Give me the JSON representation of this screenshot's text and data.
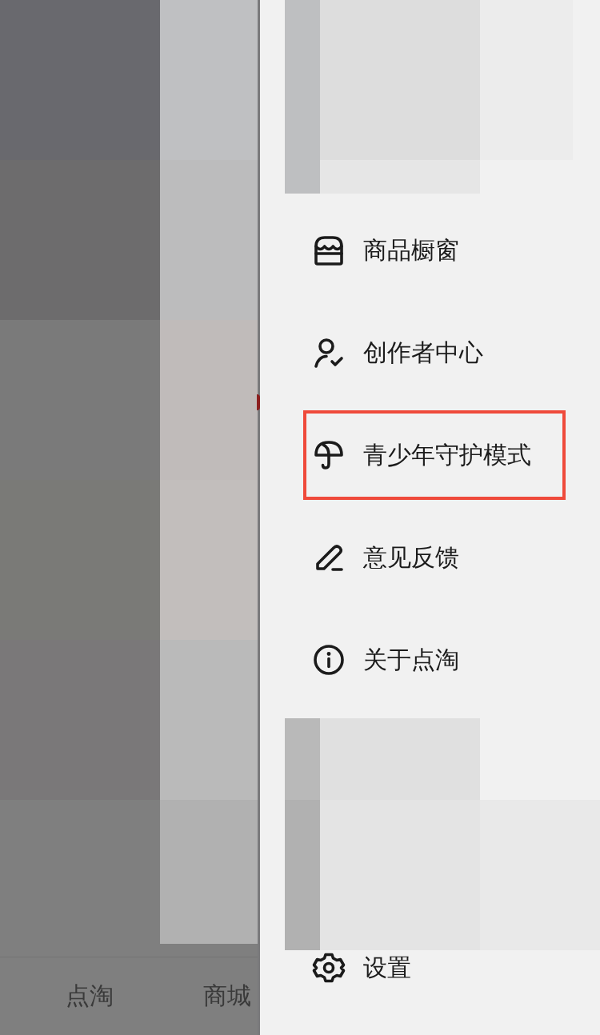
{
  "background_app": {
    "tab_bar": [
      {
        "label": "点淘"
      },
      {
        "label": "商城"
      }
    ]
  },
  "drawer": {
    "menu": [
      {
        "label": "商品橱窗",
        "highlighted": false
      },
      {
        "label": "创作者中心",
        "highlighted": false
      },
      {
        "label": "青少年守护模式",
        "highlighted": true
      },
      {
        "label": "意见反馈",
        "highlighted": false
      },
      {
        "label": "关于点淘",
        "highlighted": false
      }
    ],
    "footer_item": {
      "label": "设置"
    }
  }
}
